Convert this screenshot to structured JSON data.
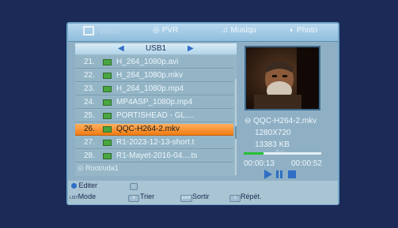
{
  "tabs": [
    {
      "label": "Vidéo",
      "icon": "film-icon"
    },
    {
      "label": "PVR",
      "icon": "record-icon"
    },
    {
      "label": "Musiqu",
      "icon": "music-note-icon"
    },
    {
      "label": "Photo",
      "icon": "photo-icon"
    }
  ],
  "source": {
    "label": "USB1"
  },
  "files": [
    {
      "num": "21.",
      "name": "H_264_1080p.avi"
    },
    {
      "num": "22.",
      "name": "H_264_1080p.mkv"
    },
    {
      "num": "23.",
      "name": "H_264_1080p.mp4"
    },
    {
      "num": "24.",
      "name": "MP4ASP_1080p.mp4"
    },
    {
      "num": "25.",
      "name": "PORTISHEAD - GL...."
    },
    {
      "num": "26.",
      "name": "QQC-H264-2.mkv",
      "selected": true
    },
    {
      "num": "27.",
      "name": "R1-2023-12-13-short.t"
    },
    {
      "num": "28.",
      "name": "R1-Mayet-2016-04....ts"
    }
  ],
  "path": "Root/uda1",
  "info": {
    "filename": "QQC-H264-2.mkv",
    "resolution": "1280X720",
    "size": "13383 KB",
    "elapsed": "00:00:13",
    "total": "00:00:52",
    "progress": 0.25
  },
  "bottom": {
    "edit": "Editer",
    "mode_key": "LIST",
    "mode": "Mode",
    "sort": "Trier",
    "exit_key": "EXIT",
    "exit": "Sortir",
    "repeat": "Répét."
  },
  "colors": {
    "selected": "#f58a22",
    "accent": "#2f6ec4",
    "progress": "#25c035"
  }
}
